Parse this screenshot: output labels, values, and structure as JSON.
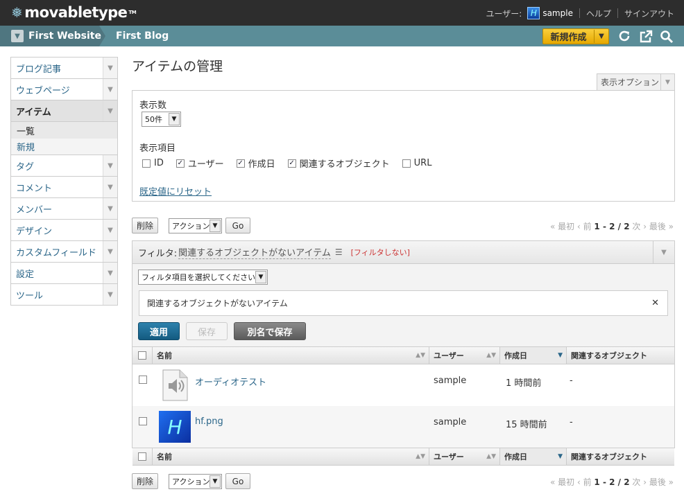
{
  "app": {
    "logo": "movabletype",
    "tm": "TM"
  },
  "topnav": {
    "user_label": "ユーザー:",
    "user_avatar_letter": "H",
    "user_name": "sample",
    "help": "ヘルプ",
    "signout": "サインアウト"
  },
  "sitebar": {
    "website": "First Website",
    "blog": "First Blog",
    "new_button": "新規作成"
  },
  "sidebar": {
    "items": [
      {
        "label": "ブログ記事"
      },
      {
        "label": "ウェブページ"
      },
      {
        "label": "アイテム"
      },
      {
        "label": "タグ"
      },
      {
        "label": "コメント"
      },
      {
        "label": "メンバー"
      },
      {
        "label": "デザイン"
      },
      {
        "label": "カスタムフィールド"
      },
      {
        "label": "設定"
      },
      {
        "label": "ツール"
      }
    ],
    "sub": {
      "list": "一覧",
      "new": "新規"
    }
  },
  "page": {
    "title": "アイテムの管理",
    "display_options_tab": "表示オプション"
  },
  "options": {
    "count_label": "表示数",
    "count_value": "50件",
    "columns_label": "表示項目",
    "columns": [
      {
        "label": "ID",
        "checked": false
      },
      {
        "label": "ユーザー",
        "checked": true
      },
      {
        "label": "作成日",
        "checked": true
      },
      {
        "label": "関連するオブジェクト",
        "checked": true
      },
      {
        "label": "URL",
        "checked": false
      }
    ],
    "reset": "既定値にリセット"
  },
  "actions": {
    "delete": "削除",
    "action_select": "アクション...",
    "go": "Go"
  },
  "pager": {
    "first": "« 最初",
    "prev": "‹ 前",
    "range": "1 - 2 / 2",
    "next": "次 ›",
    "last": "最後 »"
  },
  "filter": {
    "label": "フィルタ:",
    "name": "関連するオブジェクトがないアイテム",
    "no_filter": "[フィルタしない]",
    "select_placeholder": "フィルタ項目を選択してください",
    "condition": "関連するオブジェクトがないアイテム",
    "apply": "適用",
    "save": "保存",
    "save_as": "別名で保存"
  },
  "table": {
    "headers": {
      "name": "名前",
      "user": "ユーザー",
      "created": "作成日",
      "related": "関連するオブジェクト"
    },
    "rows": [
      {
        "name": "オーディオテスト",
        "user": "sample",
        "created": "1 時間前",
        "related": "-",
        "thumb": "audio-icon"
      },
      {
        "name": "hf.png",
        "user": "sample",
        "created": "15 時間前",
        "related": "-",
        "thumb": "image-thumb",
        "thumb_letter": "H"
      }
    ]
  },
  "colors": {
    "accent": "#5b8d98",
    "topbar": "#2d2d2d",
    "new_button": "#f9c22e",
    "apply": "#1f6c93",
    "save_as": "#6b6b6b",
    "link": "#2b6689"
  }
}
